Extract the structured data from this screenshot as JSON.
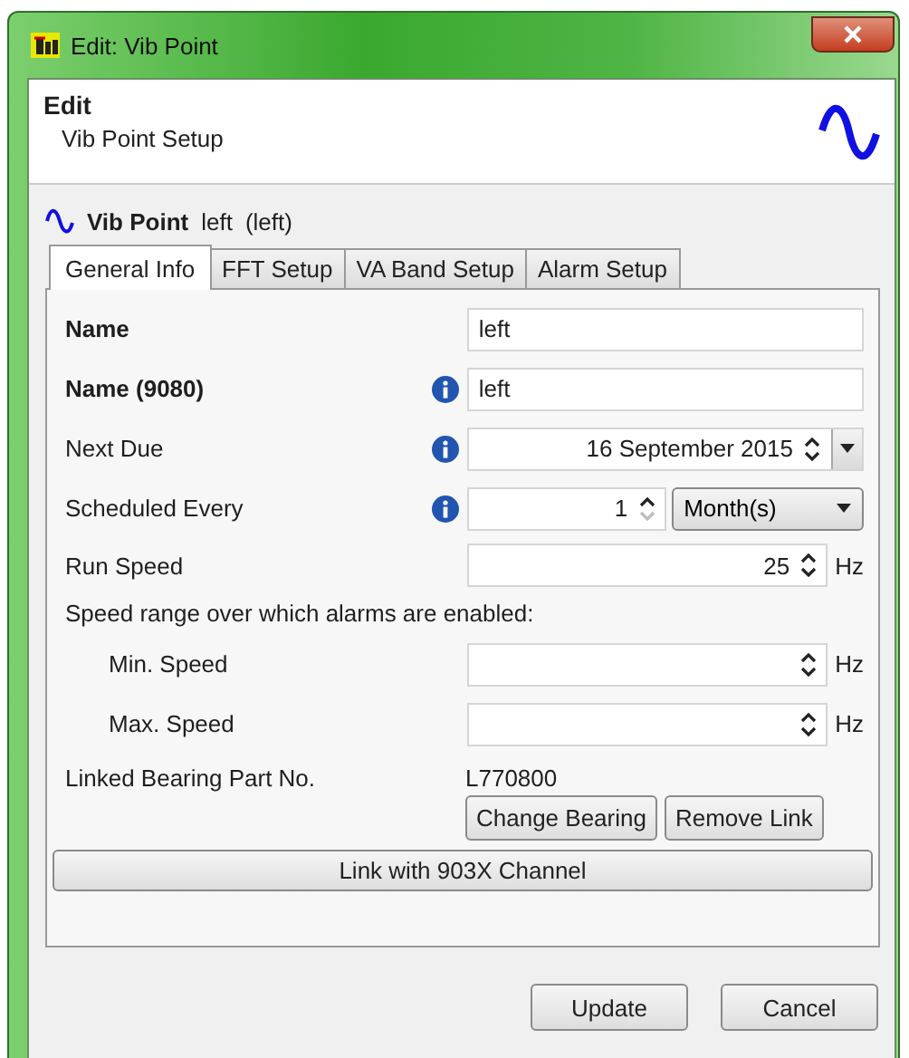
{
  "window": {
    "title": "Edit: Vib Point"
  },
  "header": {
    "title": "Edit",
    "subtitle": "Vib Point Setup"
  },
  "point": {
    "type": "Vib Point",
    "name": "left",
    "alias": "(left)"
  },
  "tabs": [
    {
      "label": "General Info",
      "selected": true
    },
    {
      "label": "FFT Setup",
      "selected": false
    },
    {
      "label": "VA Band Setup",
      "selected": false
    },
    {
      "label": "Alarm Setup",
      "selected": false
    }
  ],
  "rows": [
    {
      "kind": "text",
      "label": "Name",
      "bold": true,
      "info": false,
      "value": "left"
    },
    {
      "kind": "text",
      "label": "Name (9080)",
      "bold": true,
      "info": true,
      "value": "left"
    },
    {
      "kind": "date",
      "label": "Next Due",
      "bold": false,
      "info": true,
      "value": "16 September 2015"
    },
    {
      "kind": "interval",
      "label": "Scheduled Every",
      "bold": false,
      "info": true,
      "value": "1",
      "unit": "Month(s)"
    },
    {
      "kind": "speed",
      "label": "Run Speed",
      "bold": false,
      "info": false,
      "value": "25",
      "unit": "Hz"
    },
    {
      "kind": "note",
      "label": "Speed range over which alarms are enabled:"
    },
    {
      "kind": "speed",
      "label": "Min. Speed",
      "bold": false,
      "info": false,
      "indent": true,
      "unit": "Hz"
    },
    {
      "kind": "speed",
      "label": "Max. Speed",
      "bold": false,
      "info": false,
      "indent": true,
      "unit": "Hz"
    },
    {
      "kind": "bearing",
      "label": "Linked Bearing Part No.",
      "value": "L770800",
      "buttons": [
        "Change Bearing",
        "Remove Link"
      ]
    }
  ],
  "link_button": "Link with 903X Channel",
  "buttons": [
    "Update",
    "Cancel"
  ]
}
